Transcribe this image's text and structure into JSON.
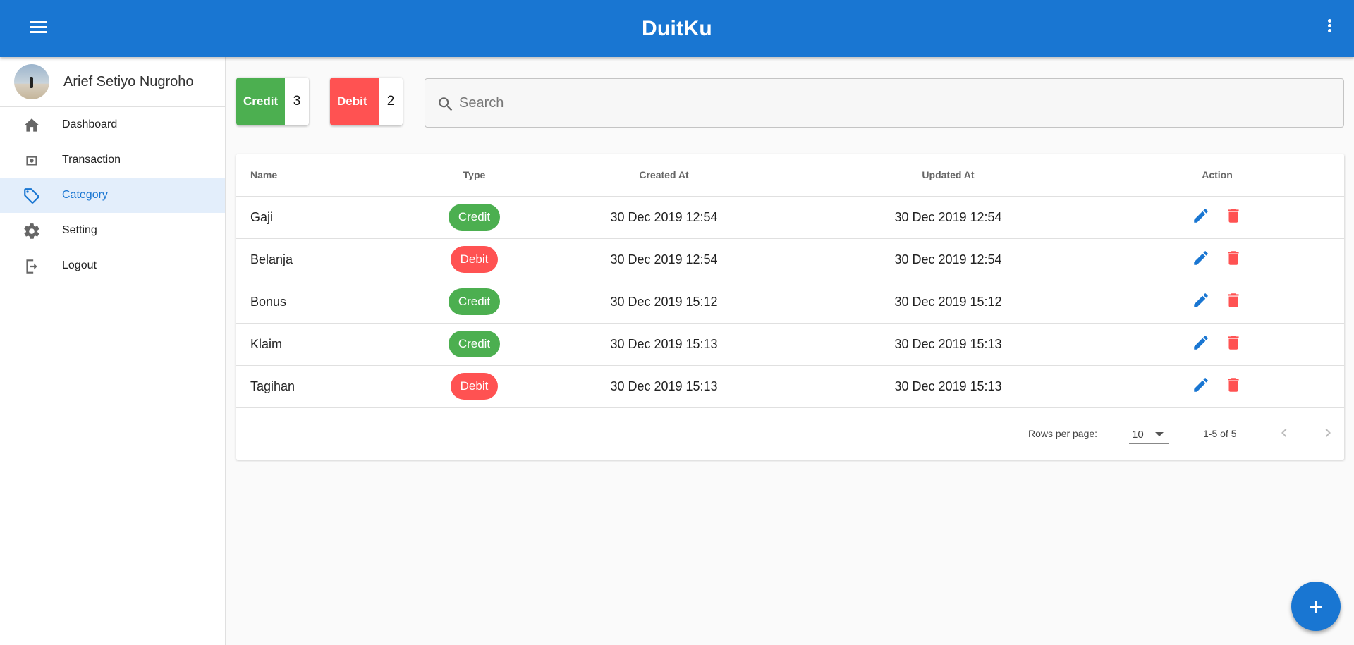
{
  "app": {
    "title": "DuitKu"
  },
  "profile": {
    "name": "Arief Setiyo Nugroho"
  },
  "sidebar": {
    "items": [
      {
        "label": "Dashboard",
        "icon": "home-icon",
        "active": false
      },
      {
        "label": "Transaction",
        "icon": "money-icon",
        "active": false
      },
      {
        "label": "Category",
        "icon": "tag-icon",
        "active": true
      },
      {
        "label": "Setting",
        "icon": "gear-icon",
        "active": false
      },
      {
        "label": "Logout",
        "icon": "logout-icon",
        "active": false
      }
    ]
  },
  "stats": {
    "credit": {
      "label": "Credit",
      "count": "3"
    },
    "debit": {
      "label": "Debit",
      "count": "2"
    }
  },
  "search": {
    "placeholder": "Search",
    "value": ""
  },
  "table": {
    "headers": {
      "name": "Name",
      "type": "Type",
      "created": "Created At",
      "updated": "Updated At",
      "action": "Action"
    },
    "rows": [
      {
        "name": "Gaji",
        "type": "Credit",
        "created": "30 Dec 2019 12:54",
        "updated": "30 Dec 2019 12:54"
      },
      {
        "name": "Belanja",
        "type": "Debit",
        "created": "30 Dec 2019 12:54",
        "updated": "30 Dec 2019 12:54"
      },
      {
        "name": "Bonus",
        "type": "Credit",
        "created": "30 Dec 2019 15:12",
        "updated": "30 Dec 2019 15:12"
      },
      {
        "name": "Klaim",
        "type": "Credit",
        "created": "30 Dec 2019 15:13",
        "updated": "30 Dec 2019 15:13"
      },
      {
        "name": "Tagihan",
        "type": "Debit",
        "created": "30 Dec 2019 15:13",
        "updated": "30 Dec 2019 15:13"
      }
    ]
  },
  "pagination": {
    "rows_label": "Rows per page:",
    "rows_value": "10",
    "range": "1-5 of 5"
  },
  "colors": {
    "primary": "#1976d2",
    "credit": "#4caf50",
    "debit": "#ff5252"
  }
}
